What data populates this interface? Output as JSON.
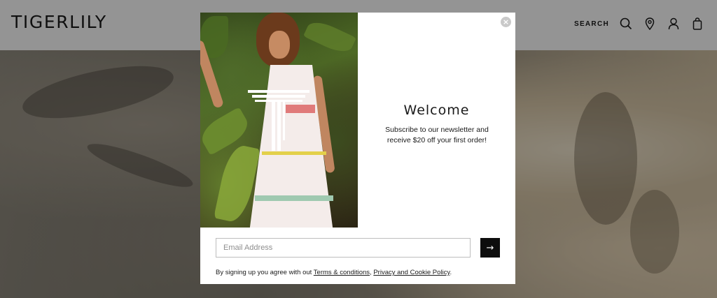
{
  "header": {
    "logo": "TIGERLILY",
    "nav": {
      "search_label": "SEARCH",
      "icons": [
        "search-icon",
        "location-pin-icon",
        "account-icon",
        "bag-icon"
      ]
    }
  },
  "modal": {
    "close_symbol": "×",
    "title": "Welcome",
    "body": "Subscribe to our newsletter and receive $20 off your first order!",
    "email": {
      "placeholder": "Email Address",
      "value": ""
    },
    "submit_symbol": "→",
    "legal": {
      "prefix": "By signing up you agree with out ",
      "terms_link": "Terms & conditions",
      "separator": ", ",
      "privacy_link": "Privacy and Cookie Policy",
      "suffix": "."
    }
  },
  "colors": {
    "header_bg": "#ffffff",
    "overlay": "rgba(0,0,0,0.42)",
    "button_bg": "#0d0d0d",
    "text": "#1a1a1a"
  }
}
